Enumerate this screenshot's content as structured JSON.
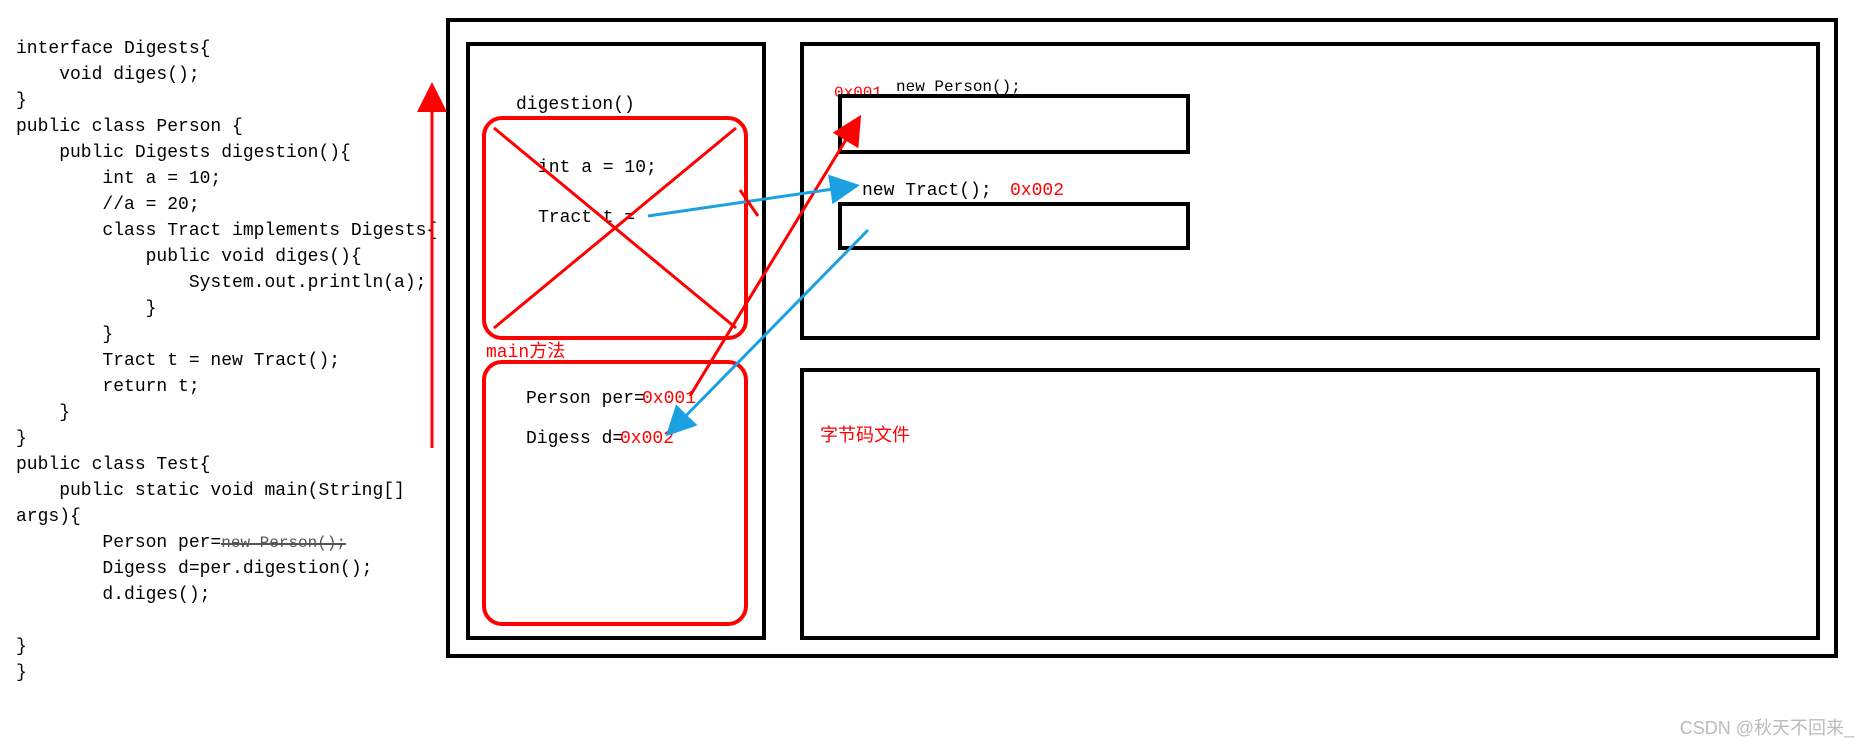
{
  "code": {
    "line01": "interface Digests{",
    "line02": "    void diges();",
    "line03": "}",
    "line04": "public class Person {",
    "line05": "    public Digests digestion(){",
    "line06": "        int a = 10;",
    "line07": "        //a = 20;",
    "line08": "        class Tract implements Digests{",
    "line09": "            public void diges(){",
    "line10": "                System.out.println(a);",
    "line11": "            }",
    "line12": "        }",
    "line13": "        Tract t = new Tract();",
    "line14": "        return t;",
    "line15": "    }",
    "line16": "}",
    "line17": "public class Test{",
    "line18": "    public static void main(String[]",
    "line19": "args){",
    "line20": "        Person per=",
    "line20b": "new Person();",
    "line21": "        Digess d=per.digestion();",
    "line22": "        d.diges();",
    "line23": "",
    "line24": "}",
    "line25": "}"
  },
  "diagram": {
    "digestion_label": "digestion()",
    "int_a": "int a = 10;",
    "tract_t": "Tract t =",
    "main_label": "main方法",
    "person_per": "Person per=",
    "digess_d": "Digess d=",
    "addr1": "0x001",
    "addr2": "0x002",
    "new_person": "new Person();",
    "new_tract": "new Tract();",
    "bytecode": "字节码文件",
    "heap_addr1": "0x001",
    "heap_addr2": "0x002"
  },
  "watermark": "CSDN @秋天不回来_"
}
